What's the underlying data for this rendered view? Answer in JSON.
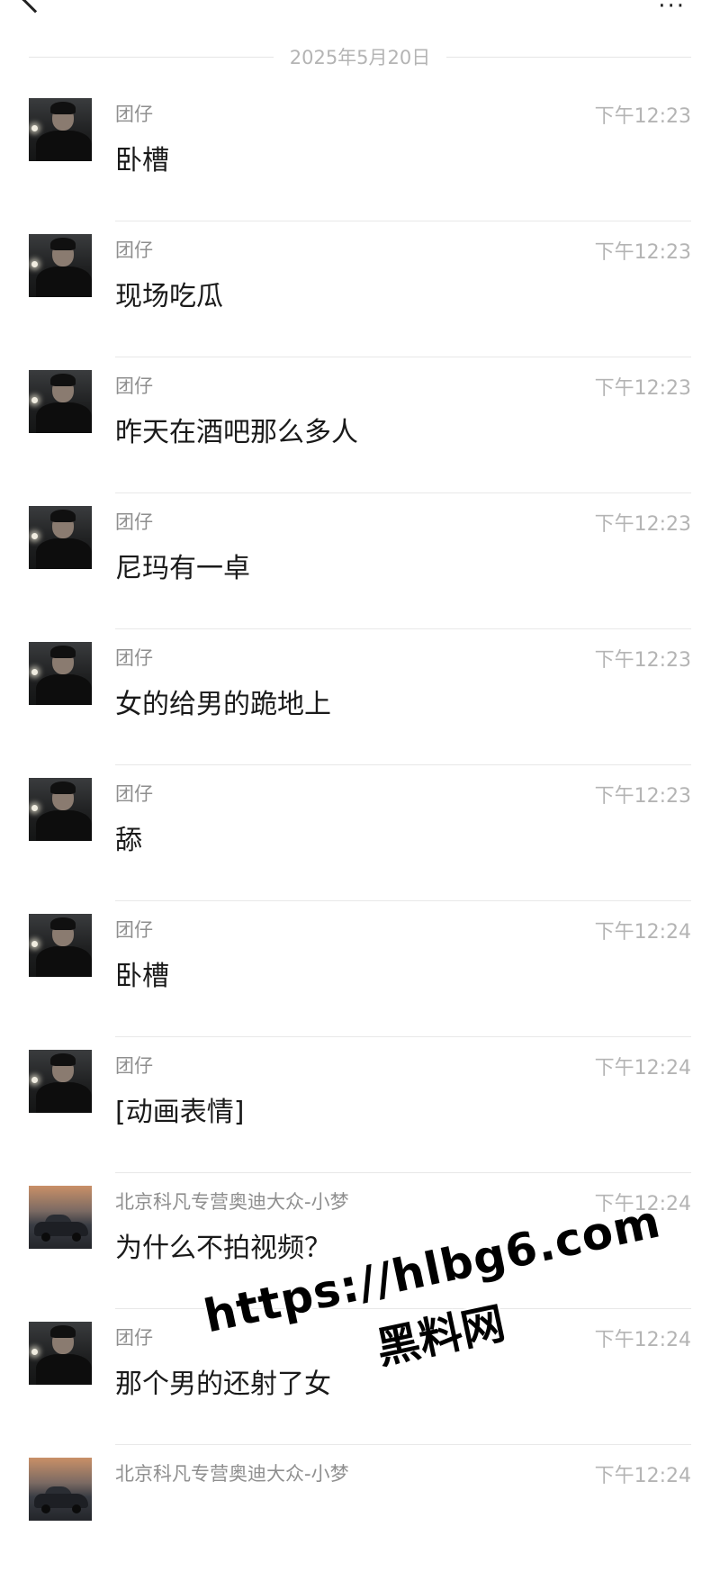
{
  "header": {
    "back_icon": "chevron-left-icon",
    "more_icon": "more-icon",
    "more_glyph": "···"
  },
  "date_divider": "2025年5月20日",
  "messages": [
    {
      "sender": "团仔",
      "time": "下午12:23",
      "text": "卧槽",
      "avatar": "person"
    },
    {
      "sender": "团仔",
      "time": "下午12:23",
      "text": "现场吃瓜",
      "avatar": "person"
    },
    {
      "sender": "团仔",
      "time": "下午12:23",
      "text": "昨天在酒吧那么多人",
      "avatar": "person"
    },
    {
      "sender": "团仔",
      "time": "下午12:23",
      "text": "尼玛有一卓",
      "avatar": "person"
    },
    {
      "sender": "团仔",
      "time": "下午12:23",
      "text": "女的给男的跪地上",
      "avatar": "person"
    },
    {
      "sender": "团仔",
      "time": "下午12:23",
      "text": "舔",
      "avatar": "person"
    },
    {
      "sender": "团仔",
      "time": "下午12:24",
      "text": "卧槽",
      "avatar": "person"
    },
    {
      "sender": "团仔",
      "time": "下午12:24",
      "text": "[动画表情]",
      "avatar": "person"
    },
    {
      "sender": "北京科凡专营奥迪大众-小梦",
      "time": "下午12:24",
      "text": "为什么不拍视频？",
      "avatar": "car"
    },
    {
      "sender": "团仔",
      "time": "下午12:24",
      "text": "那个男的还射了女",
      "avatar": "person"
    },
    {
      "sender": "北京科凡专营奥迪大众-小梦",
      "time": "下午12:24",
      "text": "",
      "avatar": "car"
    }
  ],
  "watermark": {
    "url": "https://hlbg6.com",
    "name": "黑料网"
  }
}
